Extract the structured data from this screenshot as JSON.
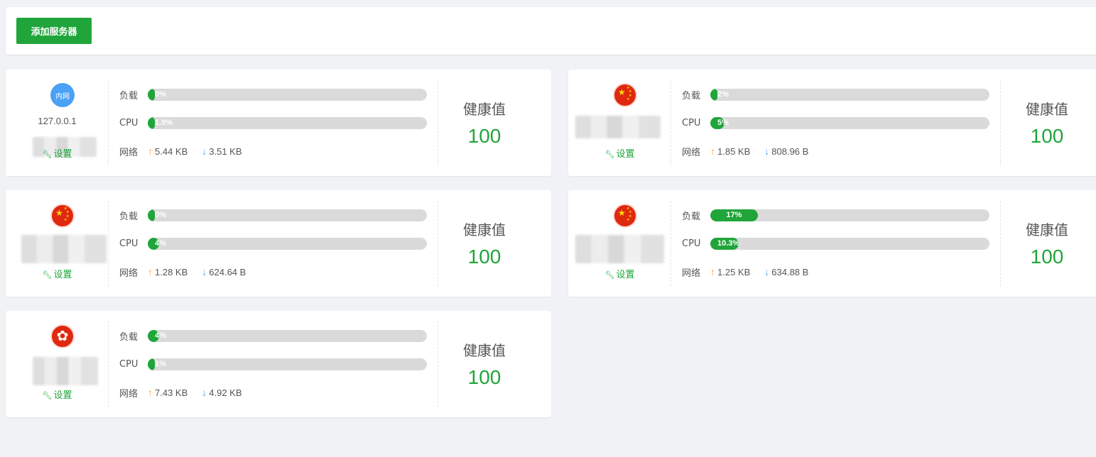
{
  "toolbar": {
    "add_server_label": "添加服务器"
  },
  "labels": {
    "load": "负载",
    "cpu": "CPU",
    "network": "网络",
    "settings": "设置",
    "health": "健康值"
  },
  "colors": {
    "accent": "#20a53a",
    "bar_bg": "#dadada",
    "up_arrow": "#f0a550",
    "down_arrow": "#5aa7f0"
  },
  "servers": [
    {
      "flag": "intranet",
      "flag_text": "内网",
      "ip": "127.0.0.1",
      "load_pct": 0,
      "load_text": "0%",
      "cpu_pct": 1.9,
      "cpu_text": "1.9%",
      "up": "5.44 KB",
      "down": "3.51 KB",
      "health": "100"
    },
    {
      "flag": "china",
      "flag_text": "",
      "ip": "",
      "load_pct": 2,
      "load_text": "2%",
      "cpu_pct": 5,
      "cpu_text": "5%",
      "up": "1.85 KB",
      "down": "808.96 B",
      "health": "100"
    },
    {
      "flag": "china",
      "flag_text": "",
      "ip": "",
      "load_pct": 0,
      "load_text": "0%",
      "cpu_pct": 4,
      "cpu_text": "4%",
      "up": "1.28 KB",
      "down": "624.64 B",
      "health": "100"
    },
    {
      "flag": "china",
      "flag_text": "",
      "ip": "",
      "load_pct": 17,
      "load_text": "17%",
      "cpu_pct": 10.3,
      "cpu_text": "10.3%",
      "up": "1.25 KB",
      "down": "634.88 B",
      "health": "100"
    },
    {
      "flag": "hongkong",
      "flag_text": "",
      "ip": "",
      "load_pct": 4,
      "load_text": "4%",
      "cpu_pct": 1,
      "cpu_text": "1%",
      "up": "7.43 KB",
      "down": "4.92 KB",
      "health": "100"
    }
  ]
}
